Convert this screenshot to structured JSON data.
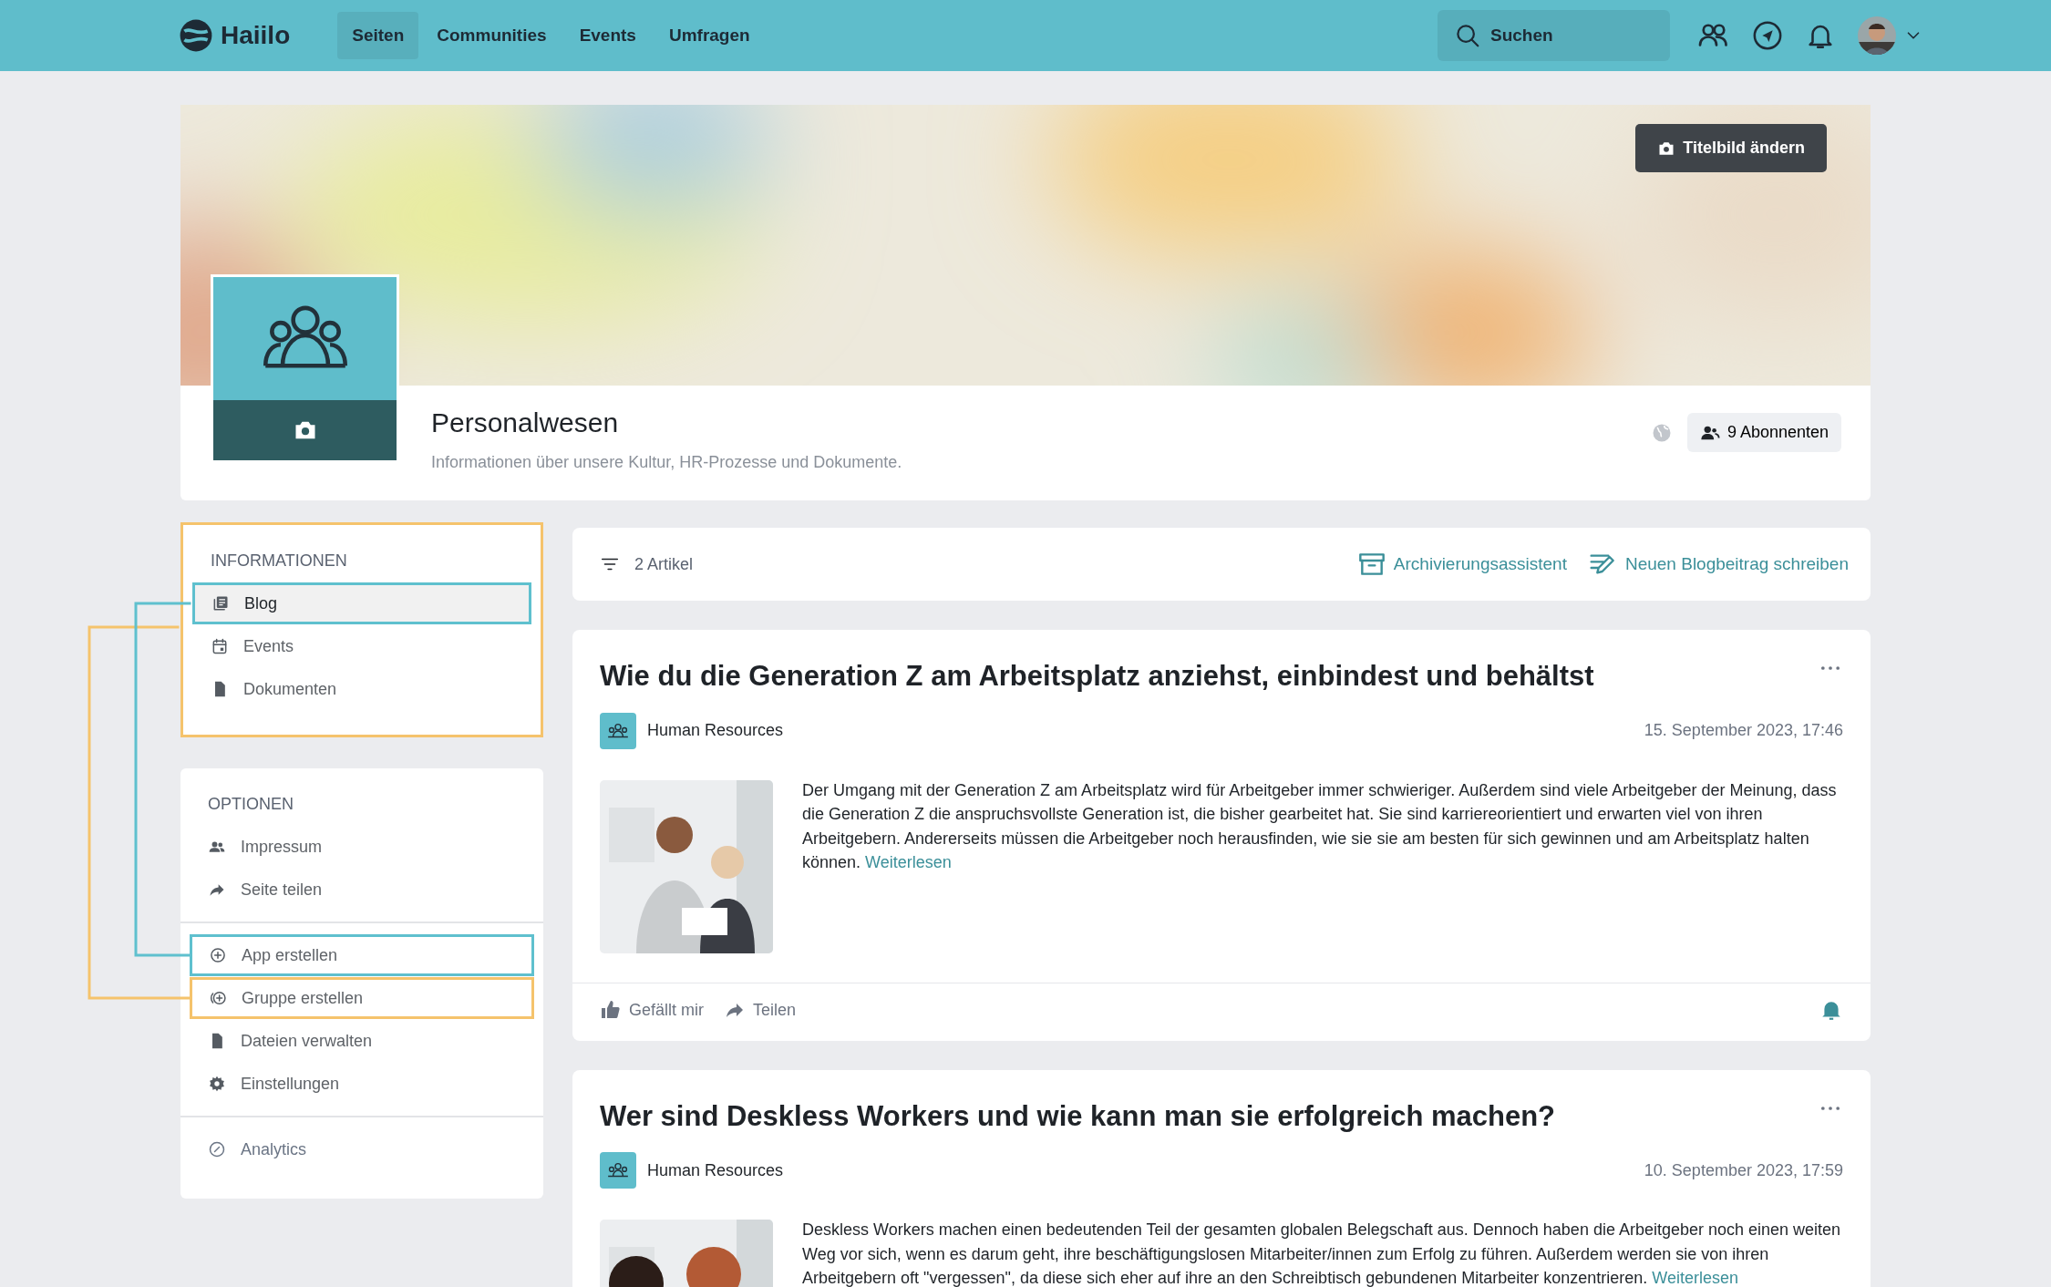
{
  "nav": {
    "brand": "Haiilo",
    "links": [
      {
        "label": "Seiten",
        "selected": true
      },
      {
        "label": "Communities",
        "selected": false
      },
      {
        "label": "Events",
        "selected": false
      },
      {
        "label": "Umfragen",
        "selected": false
      }
    ],
    "search": {
      "placeholder": "Suchen"
    }
  },
  "cover": {
    "button": "Titelbild ändern"
  },
  "page": {
    "title": "Personalwesen",
    "description": "Informationen über unsere Kultur, HR-Prozesse und Dokumente.",
    "subscribers": "9 Abonnenten"
  },
  "sidebar": [
    {
      "heading": "INFORMATIONEN",
      "color": "#f5c36c",
      "groups": [
        [
          {
            "label": "Blog",
            "kind": "blog",
            "selected": true,
            "color": "#5fc0ce"
          },
          {
            "label": "Events",
            "kind": "calendar",
            "selected": false
          },
          {
            "label": "Dokumenten",
            "kind": "file",
            "selected": false
          }
        ]
      ]
    },
    {
      "heading": "OPTIONEN",
      "groups": [
        [
          {
            "label": "Impressum",
            "kind": "people",
            "selected": false
          },
          {
            "label": "Seite teilen",
            "kind": "share",
            "selected": false
          }
        ],
        [
          {
            "label": "App erstellen",
            "kind": "plus",
            "selected": false,
            "color": "#5fc0ce"
          },
          {
            "label": "Gruppe erstellen",
            "kind": "group-plus",
            "selected": false,
            "color": "#f5c36c"
          },
          {
            "label": "Dateien verwalten",
            "kind": "file",
            "selected": false
          },
          {
            "label": "Einstellungen",
            "kind": "gear",
            "selected": false
          }
        ],
        [
          {
            "label": "Analytics",
            "kind": "gauge",
            "selected": false
          }
        ]
      ]
    }
  ],
  "toolbar": {
    "count": "2 Artikel",
    "actions": [
      "Archivierungsassistent",
      "Neuen Blogbeitrag schreiben"
    ]
  },
  "posts": [
    {
      "title": "Wie du die Generation Z am Arbeitsplatz anziehst, einbindest und behältst",
      "group": "Human Resources",
      "date": "15. September 2023, 17:46",
      "text": "Der Umgang mit der Generation Z am Arbeitsplatz wird für Arbeitgeber immer schwieriger. Außerdem sind viele Arbeitgeber der Meinung, dass die Generation Z die anspruchsvollste Generation ist, die bisher gearbeitet hat. Sie sind karriereorientiert und erwarten viel von ihren Arbeitgebern. Andererseits müssen die Arbeitgeber noch herausfinden, wie sie sie am besten für sich gewinnen und am Arbeitsplatz halten können.",
      "link": "Weiterlesen",
      "actions": [
        "Gefällt mir",
        "Teilen"
      ]
    },
    {
      "title": "Wer sind Deskless Workers und wie kann man sie erfolgreich machen?",
      "group": "Human Resources",
      "date": "10. September 2023, 17:59",
      "text": "Deskless Workers machen einen bedeutenden Teil der gesamten globalen Belegschaft aus. Dennoch haben die Arbeitgeber noch einen weiten Weg vor sich, wenn es darum geht, ihre beschäftigungslosen Mitarbeiter/innen zum Erfolg zu führen. Außerdem werden sie von ihren Arbeitgebern oft \"vergessen\", da diese sich eher auf ihre an den Schreibtisch gebundenen Mitarbeiter konzentrieren.",
      "link": "Weiterlesen"
    }
  ]
}
